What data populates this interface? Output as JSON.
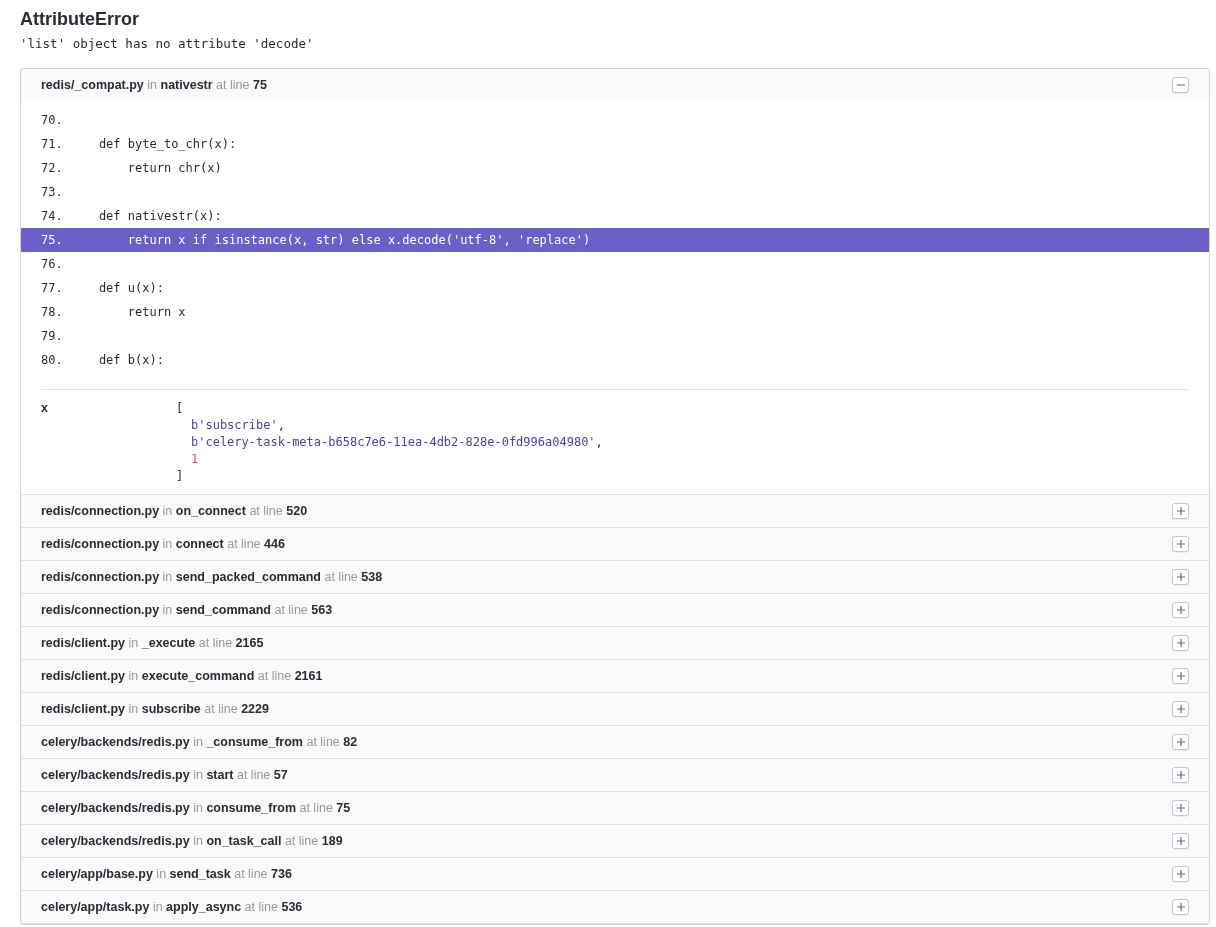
{
  "error": {
    "type": "AttributeError",
    "message": "'list' object has no attribute 'decode'"
  },
  "frames": [
    {
      "title": "**redis/_compat.py** in **nativestr** at line **75**",
      "expanded": true,
      "context": [
        {
          "number": "70.",
          "highlighted": false
        },
        {
          "number": "71.",
          "code": "    def byte_to_chr(x):",
          "highlighted": false
        },
        {
          "number": "72.",
          "code": "        return chr(x)",
          "highlighted": false
        },
        {
          "number": "73.",
          "highlighted": false
        },
        {
          "number": "74.",
          "code": "    def nativestr(x):",
          "highlighted": false
        },
        {
          "number": "75.",
          "code": "        return x if isinstance(x, str) else x.decode('utf-8', 'replace')",
          "highlighted": true
        },
        {
          "number": "76.",
          "highlighted": false
        },
        {
          "number": "77.",
          "code": "    def u(x):",
          "highlighted": false
        },
        {
          "number": "78.",
          "code": "        return x",
          "highlighted": false
        },
        {
          "number": "79.",
          "highlighted": false
        },
        {
          "number": "80.",
          "code": "    def b(x):",
          "highlighted": false
        }
      ],
      "locals": [
        {
          "name": "x",
          "value": [
            {
              "kind": "bracket",
              "text": "["
            },
            {
              "kind": "string",
              "text": "b'subscribe'",
              "suffix": ","
            },
            {
              "kind": "string",
              "text": "b'celery-task-meta-b658c7e6-11ea-4db2-828e-0fd996a04980'",
              "suffix": ","
            },
            {
              "kind": "number",
              "text": "1"
            },
            {
              "kind": "bracket",
              "text": "]"
            }
          ]
        }
      ]
    },
    {
      "title": "**redis/connection.py** in **on_connect** at line **520**",
      "expanded": false
    },
    {
      "title": "**redis/connection.py** in **connect** at line **446**",
      "expanded": false
    },
    {
      "title": "**redis/connection.py** in **send_packed_command** at line **538**",
      "expanded": false
    },
    {
      "title": "**redis/connection.py** in **send_command** at line **563**",
      "expanded": false
    },
    {
      "title": "**redis/client.py** in **_execute** at line **2165**",
      "expanded": false
    },
    {
      "title": "**redis/client.py** in **execute_command** at line **2161**",
      "expanded": false
    },
    {
      "title": "**redis/client.py** in **subscribe** at line **2229**",
      "expanded": false
    },
    {
      "title": "**celery/backends/redis.py** in **_consume_from** at line **82**",
      "expanded": false
    },
    {
      "title": "**celery/backends/redis.py** in **start** at line **57**",
      "expanded": false
    },
    {
      "title": "**celery/backends/redis.py** in **consume_from** at line **75**",
      "expanded": false
    },
    {
      "title": "**celery/backends/redis.py** in **on_task_call** at line **189**",
      "expanded": false
    },
    {
      "title": "**celery/app/base.py** in **send_task** at line **736**",
      "expanded": false
    },
    {
      "title": "**celery/app/task.py** in **apply_async** at line **536**",
      "expanded": false
    }
  ]
}
